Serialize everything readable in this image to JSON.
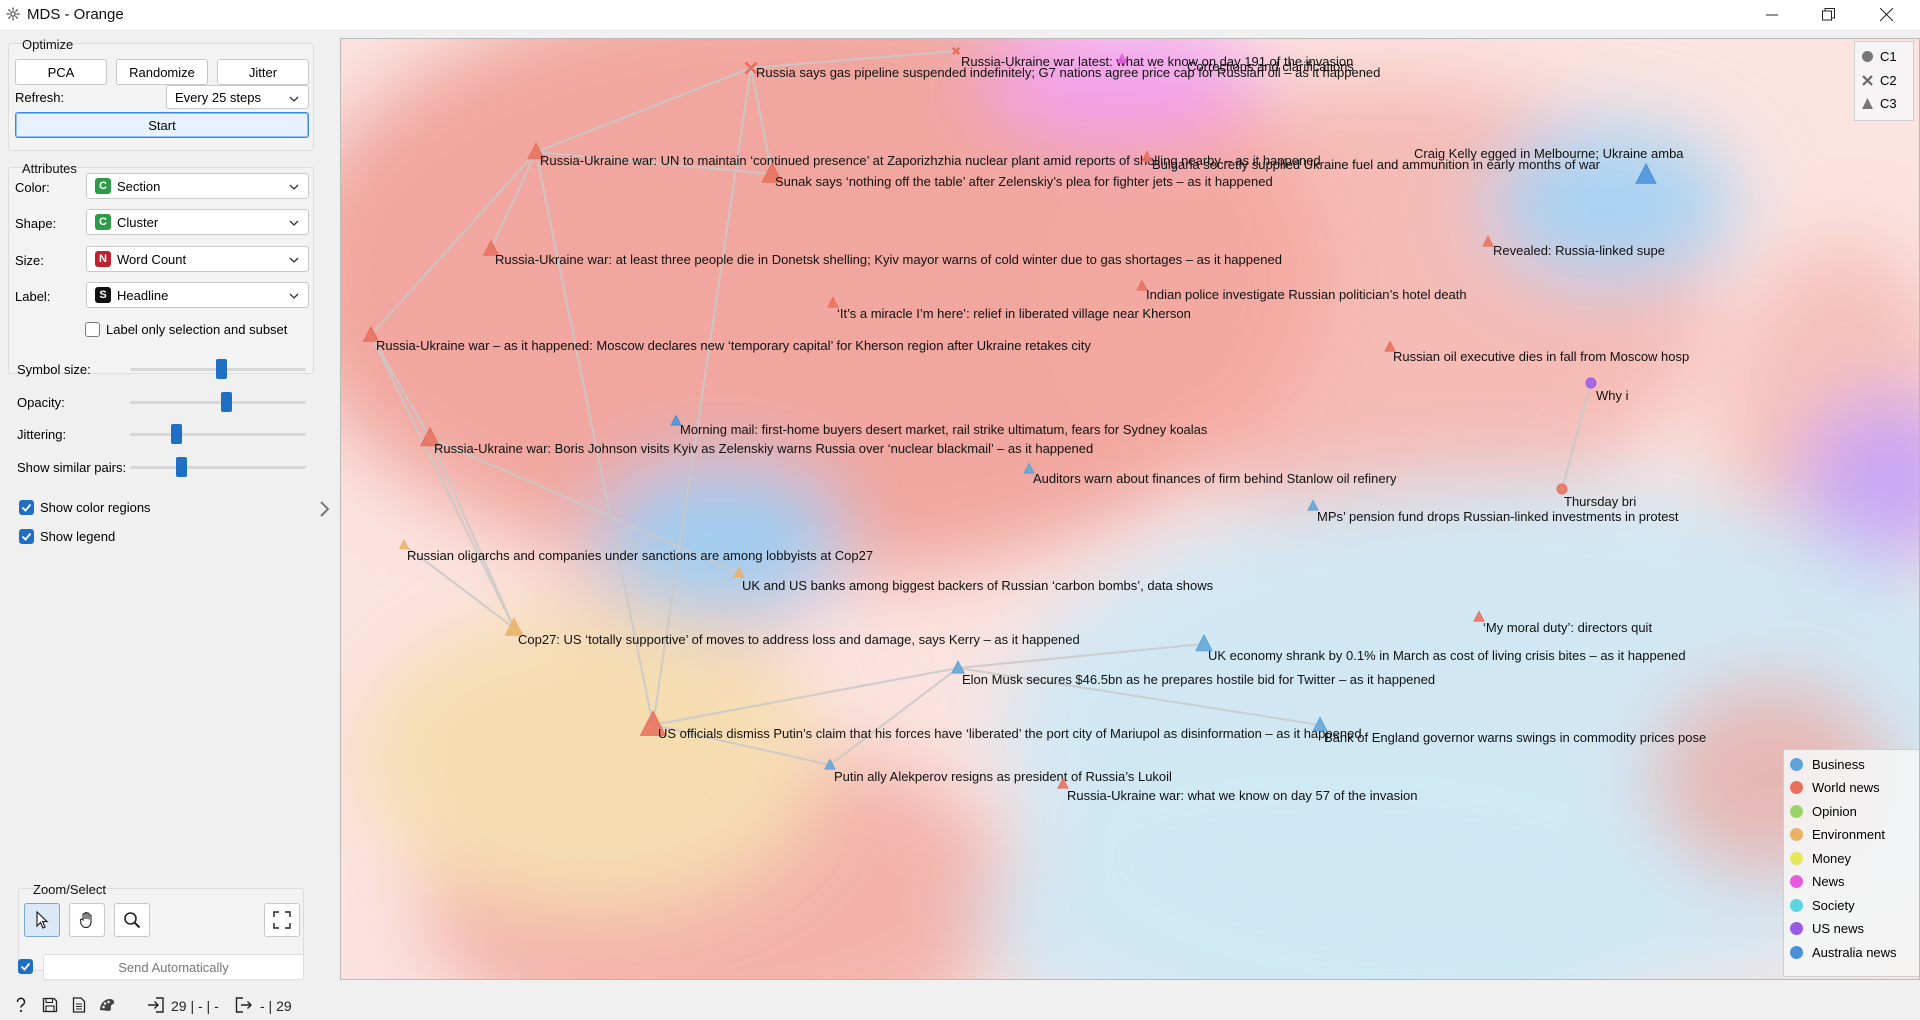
{
  "window": {
    "title": "MDS - Orange"
  },
  "optimize": {
    "title": "Optimize",
    "pca_label": "PCA",
    "randomize_label": "Randomize",
    "jitter_label": "Jitter",
    "refresh_label": "Refresh:",
    "refresh_value": "Every 25 steps",
    "start_label": "Start"
  },
  "attributes": {
    "title": "Attributes",
    "color_label": "Color:",
    "color_value": "Section",
    "color_badge": "C",
    "shape_label": "Shape:",
    "shape_value": "Cluster",
    "shape_badge": "C",
    "size_label": "Size:",
    "size_value": "Word Count",
    "size_badge": "N",
    "label_label": "Label:",
    "label_value": "Headline",
    "label_badge": "S",
    "label_only_selection": "Label only selection and subset",
    "label_only_selection_checked": false
  },
  "sliders": [
    {
      "label": "Symbol size:",
      "value": 0.52
    },
    {
      "label": "Opacity:",
      "value": 0.55
    },
    {
      "label": "Jittering:",
      "value": 0.25
    },
    {
      "label": "Show similar pairs:",
      "value": 0.28
    }
  ],
  "checkboxes": {
    "show_color_regions": "Show color regions",
    "show_color_regions_checked": true,
    "show_legend": "Show legend",
    "show_legend_checked": true
  },
  "zoom_select": {
    "title": "Zoom/Select",
    "tools": [
      "pointer-icon",
      "hand-icon",
      "zoom-icon"
    ],
    "reset": "fit-icon"
  },
  "send_automatically": {
    "label": "Send Automatically",
    "checked": true
  },
  "statusbar": {
    "input_count": "29 | - | -",
    "output_count": "- | 29"
  },
  "legend_shapes": [
    {
      "name": "C1",
      "shape": "circle"
    },
    {
      "name": "C2",
      "shape": "cross"
    },
    {
      "name": "C3",
      "shape": "triangle"
    }
  ],
  "legend_colors": [
    {
      "name": "Business",
      "color": "#5fa3d8"
    },
    {
      "name": "World news",
      "color": "#e8705c"
    },
    {
      "name": "Opinion",
      "color": "#9dd46a"
    },
    {
      "name": "Environment",
      "color": "#e9b266"
    },
    {
      "name": "Money",
      "color": "#e6e65a"
    },
    {
      "name": "News",
      "color": "#e65ae0"
    },
    {
      "name": "Society",
      "color": "#5ad6e0"
    },
    {
      "name": "US news",
      "color": "#9b5ae6"
    },
    {
      "name": "Australia news",
      "color": "#4a90d9"
    }
  ],
  "points": [
    {
      "label": "Russia-Ukraine war latest: what we know on day 191 of the invasion",
      "shape": "cross",
      "section": "World news",
      "size": 7
    },
    {
      "label": "Corrections and clarifications",
      "shape": "triangle",
      "section": "News",
      "size": 7
    },
    {
      "label": "Russia says gas pipeline suspended indefinitely; G7 nations agree price cap for Russian oil – as it happened",
      "shape": "cross",
      "section": "World news",
      "size": 12
    },
    {
      "label": "Craig Kelly egged in Melbourne; Ukraine amba",
      "shape": "triangle",
      "section": "Australia news",
      "size": 16
    },
    {
      "label": "Russia-Ukraine war: UN to maintain ‘continued presence’ at Zaporizhzhia nuclear plant amid reports of shelling nearby – as it happened",
      "shape": "triangle",
      "section": "World news",
      "size": 13
    },
    {
      "label": "Bulgaria secretly supplied Ukraine fuel and ammunition in early months of war",
      "shape": "triangle",
      "section": "World news",
      "size": 8
    },
    {
      "label": "Sunak says ‘nothing off the table’ after Zelenskiy’s plea for fighter jets – as it happened",
      "shape": "triangle",
      "section": "World news",
      "size": 16
    },
    {
      "label": "Russia-Ukraine war: at least three people die in Donetsk shelling; Kyiv mayor warns of cold winter due to gas shortages – as it happened",
      "shape": "triangle",
      "section": "World news",
      "size": 12
    },
    {
      "label": "Revealed: Russia-linked supe",
      "shape": "triangle",
      "section": "World news",
      "size": 8
    },
    {
      "label": "Indian police investigate Russian politician’s hotel death",
      "shape": "triangle",
      "section": "World news",
      "size": 8
    },
    {
      "label": "‘It’s a miracle I’m here’: relief in liberated village near Kherson",
      "shape": "triangle",
      "section": "World news",
      "size": 8
    },
    {
      "label": "Russia-Ukraine war – as it happened: Moscow declares new ‘temporary capital’ for Kherson region after Ukraine retakes city",
      "shape": "triangle",
      "section": "World news",
      "size": 12
    },
    {
      "label": "Russian oil executive dies in fall from Moscow hosp",
      "shape": "triangle",
      "section": "World news",
      "size": 8
    },
    {
      "label": "Why i",
      "shape": "circle",
      "section": "US news",
      "size": 10
    },
    {
      "label": "Morning mail: first-home buyers desert market, rail strike ultimatum, fears for Sydney koalas",
      "shape": "triangle",
      "section": "Australia news",
      "size": 8
    },
    {
      "label": "Russia-Ukraine war: Boris Johnson visits Kyiv as Zelenskiy warns Russia over ‘nuclear blackmail’ – as it happened",
      "shape": "triangle",
      "section": "World news",
      "size": 15
    },
    {
      "label": "Auditors warn about finances of firm behind Stanlow oil refinery",
      "shape": "triangle",
      "section": "Business",
      "size": 8
    },
    {
      "label": "Thursday bri",
      "shape": "circle",
      "section": "World news",
      "size": 10
    },
    {
      "label": "MPs’ pension fund drops Russian-linked investments in protest",
      "shape": "triangle",
      "section": "Business",
      "size": 8
    },
    {
      "label": "Russian oligarchs and companies under sanctions are among lobbyists at Cop27",
      "shape": "triangle",
      "section": "Environment",
      "size": 7
    },
    {
      "label": "UK and US banks among biggest backers of Russian ‘carbon bombs’, data shows",
      "shape": "triangle",
      "section": "Environment",
      "size": 8
    },
    {
      "label": "‘My moral duty’: directors quit",
      "shape": "triangle",
      "section": "World news",
      "size": 8
    },
    {
      "label": "Cop27: US ‘totally supportive’ of moves to address loss and damage, says Kerry – as it happened",
      "shape": "triangle",
      "section": "Environment",
      "size": 14
    },
    {
      "label": "UK economy shrank by 0.1% in March as cost of living crisis bites – as it happened",
      "shape": "triangle",
      "section": "Business",
      "size": 13
    },
    {
      "label": "Elon Musk secures $46.5bn as he prepares hostile bid for Twitter – as it happened",
      "shape": "triangle",
      "section": "Business",
      "size": 10
    },
    {
      "label": "US officials dismiss Putin’s claim that his forces have ‘liberated’ the port city of Mariupol as disinformation – as it happened",
      "shape": "triangle",
      "section": "World news",
      "size": 20
    },
    {
      "label": "Bank of England governor warns swings in commodity prices pose",
      "shape": "triangle",
      "section": "Business",
      "size": 11
    },
    {
      "label": "Putin ally Alekperov resigns as president of Russia’s Lukoil",
      "shape": "triangle",
      "section": "Business",
      "size": 8
    },
    {
      "label": "Russia-Ukraine war: what we know on day 57 of the invasion",
      "shape": "triangle",
      "section": "World news",
      "size": 8
    }
  ]
}
